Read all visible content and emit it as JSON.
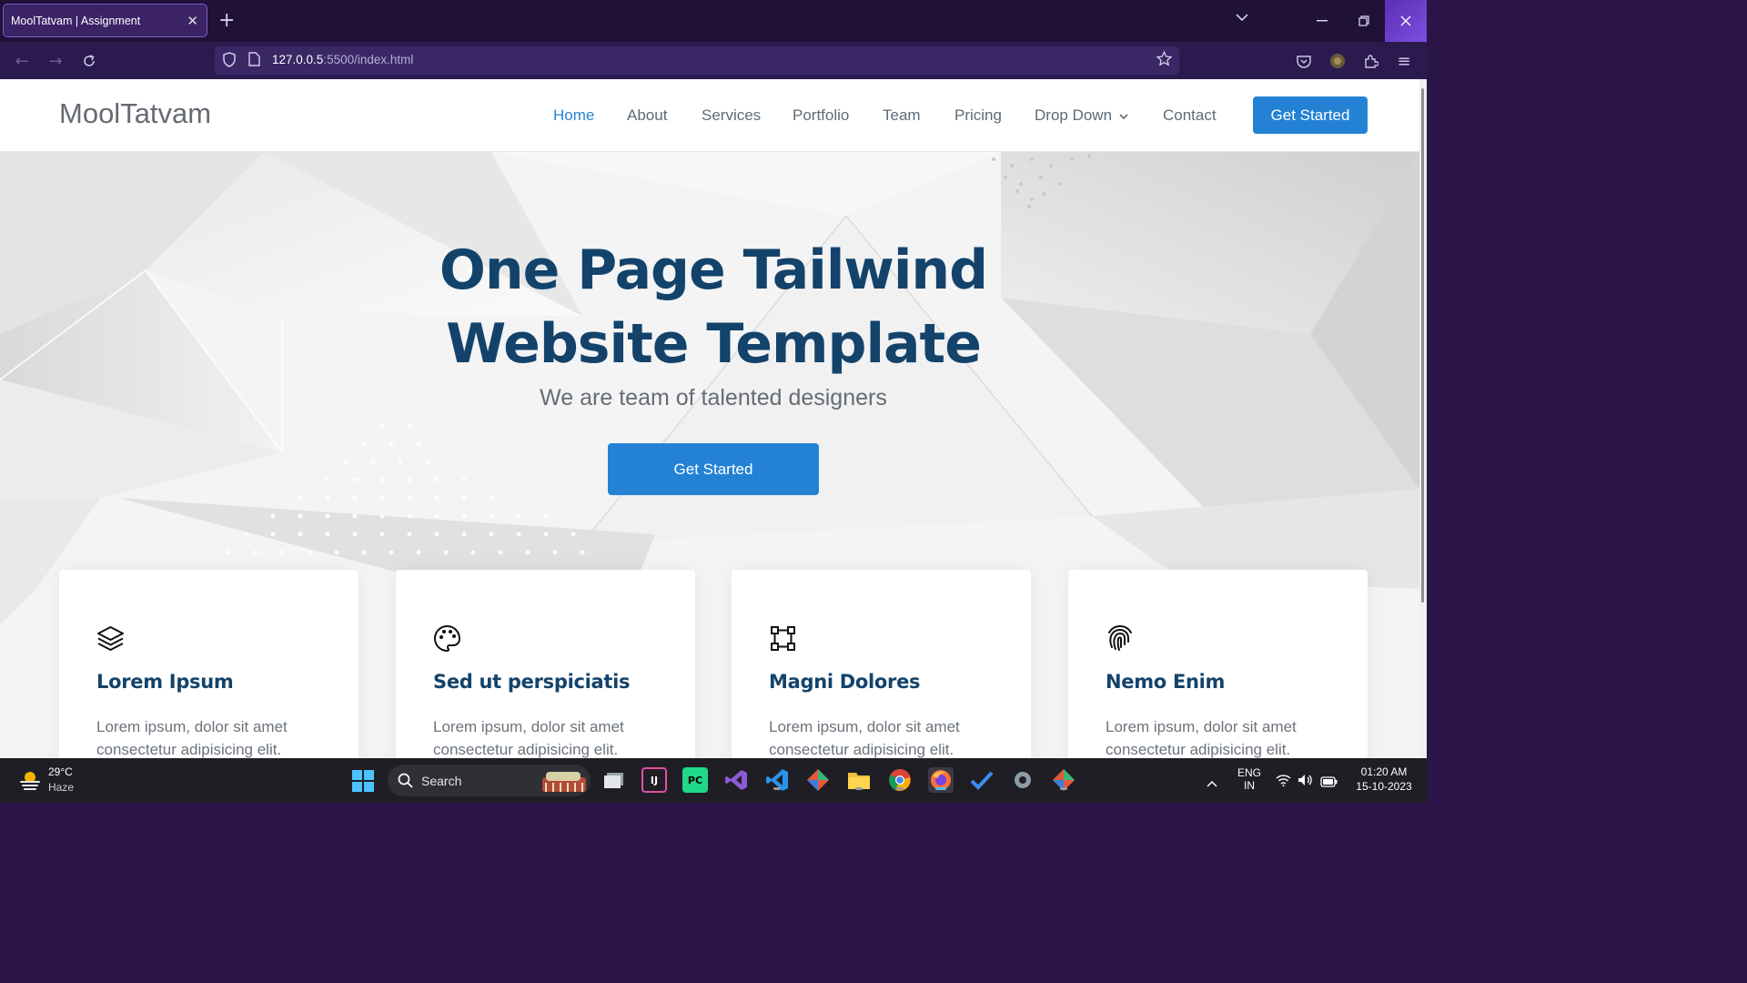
{
  "browser": {
    "tab_title": "MoolTatvam | Assignment",
    "url_host": "127.0.0.5",
    "url_rest": ":5500/index.html"
  },
  "site": {
    "logo": "MoolTatvam",
    "nav": [
      "Home",
      "About",
      "Services",
      "Portfolio",
      "Team",
      "Pricing",
      "Drop Down",
      "Contact"
    ],
    "header_cta": "Get Started",
    "hero_title_line1": "One Page Tailwind",
    "hero_title_line2": "Website Template",
    "hero_subtitle": "We are team of talented designers",
    "hero_cta": "Get Started",
    "cards": [
      {
        "icon": "layers-icon",
        "title": "Lorem Ipsum",
        "text": "Lorem ipsum, dolor sit amet consectetur adipisicing elit."
      },
      {
        "icon": "palette-icon",
        "title": "Sed ut perspiciatis",
        "text": "Lorem ipsum, dolor sit amet consectetur adipisicing elit."
      },
      {
        "icon": "bounding-box-icon",
        "title": "Magni Dolores",
        "text": "Lorem ipsum, dolor sit amet consectetur adipisicing elit."
      },
      {
        "icon": "fingerprint-icon",
        "title": "Nemo Enim",
        "text": "Lorem ipsum, dolor sit amet consectetur adipisicing elit."
      }
    ],
    "colors": {
      "accent": "#2382d4",
      "heading": "#13436b"
    }
  },
  "taskbar": {
    "temperature": "29°C",
    "weather": "Haze",
    "search_label": "Search",
    "lang_line1": "ENG",
    "lang_line2": "IN",
    "time": "01:20 AM",
    "date": "15-10-2023"
  }
}
